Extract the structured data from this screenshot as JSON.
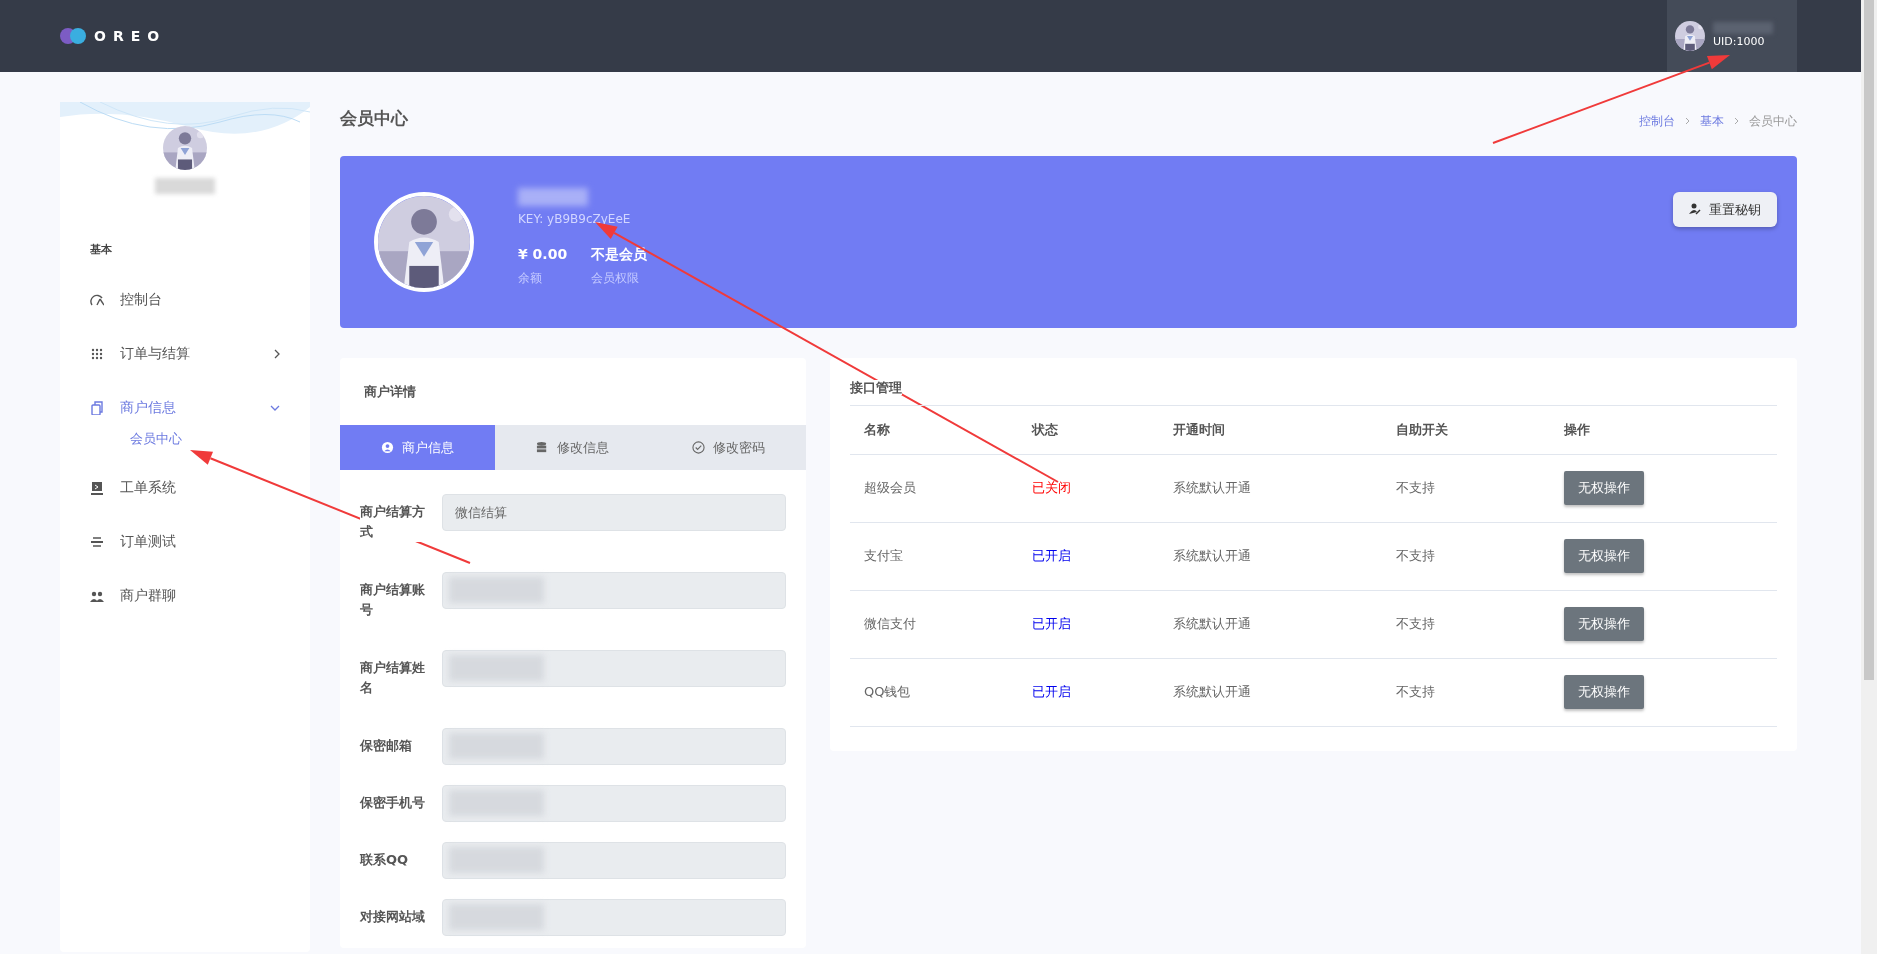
{
  "header": {
    "logo": "OREO",
    "uid": "UID:1000"
  },
  "sidebar": {
    "section": "基本",
    "items": [
      {
        "label": "控制台",
        "selected": false
      },
      {
        "label": "订单与结算",
        "selected": false,
        "expanded": false
      },
      {
        "label": "商户信息",
        "selected": true,
        "expanded": true,
        "children": [
          {
            "label": "会员中心",
            "selected": true
          }
        ]
      },
      {
        "label": "工单系统",
        "selected": false
      },
      {
        "label": "订单测试",
        "selected": false
      },
      {
        "label": "商户群聊",
        "selected": false
      }
    ]
  },
  "page": {
    "title": "会员中心",
    "breadcrumb": [
      {
        "label": "控制台",
        "link": true
      },
      {
        "label": "基本",
        "link": true
      },
      {
        "label": "会员中心",
        "link": false
      }
    ]
  },
  "profile": {
    "key": "KEY: yB9B9cZyEeE",
    "stats": [
      {
        "value": "¥ 0.00",
        "label": "余额"
      },
      {
        "value": "不是会员",
        "label": "会员权限"
      }
    ],
    "button": "重置秘钥"
  },
  "details": {
    "title": "商户详情",
    "tabs": [
      {
        "label": "商户信息",
        "selected": true
      },
      {
        "label": "修改信息",
        "selected": false
      },
      {
        "label": "修改密码",
        "selected": false
      }
    ],
    "fields": [
      {
        "label": "商户结算方式",
        "value": "微信结算"
      },
      {
        "label": "商户结算账号"
      },
      {
        "label": "商户结算姓名"
      },
      {
        "label": "保密邮箱"
      },
      {
        "label": "保密手机号"
      },
      {
        "label": "联系QQ"
      },
      {
        "label": "对接网站域"
      }
    ]
  },
  "interfaces": {
    "title": "接口管理",
    "columns": [
      "名称",
      "状态",
      "开通时间",
      "自助开关",
      "操作"
    ],
    "rows": [
      {
        "name": "超级会员",
        "status": "已关闭",
        "enabled": false,
        "time": "系统默认开通",
        "self": "不支持",
        "action": "无权操作"
      },
      {
        "name": "支付宝",
        "status": "已开启",
        "enabled": true,
        "time": "系统默认开通",
        "self": "不支持",
        "action": "无权操作"
      },
      {
        "name": "微信支付",
        "status": "已开启",
        "enabled": true,
        "time": "系统默认开通",
        "self": "不支持",
        "action": "无权操作"
      },
      {
        "name": "QQ钱包",
        "status": "已开启",
        "enabled": true,
        "time": "系统默认开通",
        "self": "不支持",
        "action": "无权操作"
      }
    ]
  }
}
